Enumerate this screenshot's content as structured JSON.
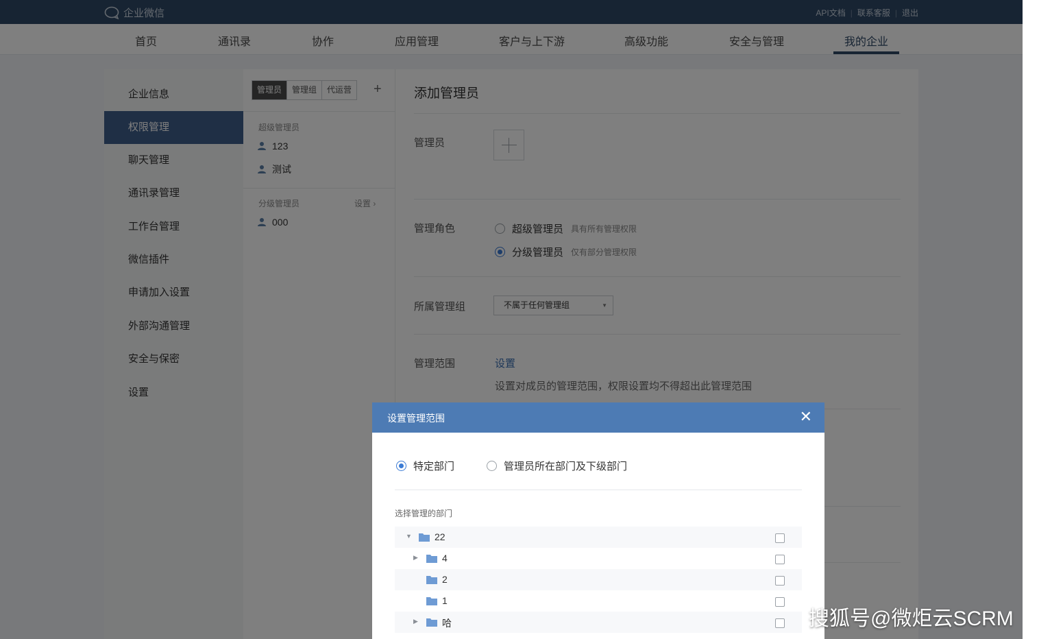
{
  "topbar": {
    "brand": "企业微信",
    "links": [
      "API文档",
      "联系客服",
      "退出"
    ]
  },
  "nav": {
    "items": [
      "首页",
      "通讯录",
      "协作",
      "应用管理",
      "客户与上下游",
      "高级功能",
      "安全与管理",
      "我的企业"
    ],
    "active": "我的企业"
  },
  "sidebar": {
    "items": [
      "企业信息",
      "权限管理",
      "聊天管理",
      "通讯录管理",
      "工作台管理",
      "微信插件",
      "申请加入设置",
      "外部沟通管理",
      "安全与保密",
      "设置"
    ],
    "active": "权限管理"
  },
  "admin_tabs": {
    "tabs": [
      "管理员",
      "管理组",
      "代运营"
    ],
    "active": "管理员",
    "add_symbol": "+"
  },
  "super_admins": {
    "title": "超级管理员",
    "members": [
      "123",
      "测试"
    ]
  },
  "sub_admins": {
    "title": "分级管理员",
    "setting_label": "设置",
    "members": [
      "000"
    ]
  },
  "form": {
    "title": "添加管理员",
    "admin_label": "管理员",
    "role_label": "管理角色",
    "roles": [
      {
        "label": "超级管理员",
        "desc": "具有所有管理权限",
        "selected": false
      },
      {
        "label": "分级管理员",
        "desc": "仅有部分管理权限",
        "selected": true
      }
    ],
    "group_label": "所属管理组",
    "group_value": "不属于任何管理组",
    "scope_label": "管理范围",
    "scope_link": "设置",
    "scope_hint": "设置对成员的管理范围，权限设置均不得超出此管理范围"
  },
  "modal": {
    "title": "设置管理范围",
    "close_symbol": "✕",
    "options": [
      {
        "label": "特定部门",
        "selected": true
      },
      {
        "label": "管理员所在部门及下级部门",
        "selected": false
      }
    ],
    "tree_title": "选择管理的部门",
    "tree": [
      {
        "name": "22",
        "depth": 0,
        "arrow": "▼"
      },
      {
        "name": "4",
        "depth": 1,
        "arrow": "▶"
      },
      {
        "name": "2",
        "depth": 1,
        "arrow": ""
      },
      {
        "name": "1",
        "depth": 1,
        "arrow": ""
      },
      {
        "name": "哈",
        "depth": 1,
        "arrow": "▶"
      }
    ]
  },
  "watermark": "搜狐号@微炬云SCRM",
  "colors": {
    "topbar": "#2f4866",
    "active_sidebar": "#3e5f8a",
    "modal_header": "#4d7bb4",
    "accent": "#3b7bd4"
  }
}
